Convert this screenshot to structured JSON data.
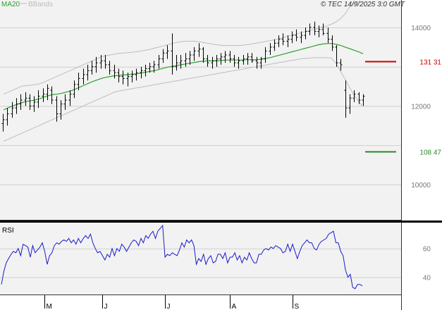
{
  "header": {
    "ma_label": "MA20",
    "bb_label": "BBands",
    "stamp": "© TEC 14/9/2025 3:0 GMT"
  },
  "colors": {
    "panel_bg": "#f2f2f2",
    "grid": "#cfcfcf",
    "price_bar": "#000000",
    "ma": "#2ca02c",
    "bbands": "#bdbdbd",
    "rsi_line": "#1a1acc",
    "resistance": "#cc0000",
    "support": "#2a8a2a",
    "tick_text": "#777777"
  },
  "chart_data": [
    {
      "type": "ohlc",
      "panel": "price",
      "x": [
        "start",
        "end"
      ],
      "ylim": [
        9100,
        14700
      ],
      "yticks": [
        10000,
        12000,
        14000
      ],
      "ytick_labels": [
        "10000",
        "12000",
        "14000"
      ],
      "grid": true,
      "legend": "top-left",
      "levels": [
        {
          "name": "resistance",
          "value": 13131,
          "label": "131 31",
          "color": "#cc0000"
        },
        {
          "name": "support",
          "value": 10847,
          "label": "108 47",
          "color": "#2a8a2a"
        }
      ],
      "bars": [
        [
          11550,
          11800,
          11350,
          11650
        ],
        [
          11650,
          11950,
          11500,
          11800
        ],
        [
          11800,
          12100,
          11700,
          11950
        ],
        [
          11950,
          12200,
          11800,
          12050
        ],
        [
          12050,
          12300,
          11900,
          12150
        ],
        [
          12150,
          12350,
          12000,
          12200
        ],
        [
          12200,
          12300,
          11900,
          12000
        ],
        [
          12000,
          12250,
          11850,
          12100
        ],
        [
          12100,
          12400,
          11950,
          12250
        ],
        [
          12250,
          12450,
          12100,
          12300
        ],
        [
          12300,
          12550,
          12150,
          12450
        ],
        [
          12400,
          12500,
          12050,
          12150
        ],
        [
          12150,
          12250,
          11600,
          11800
        ],
        [
          11800,
          12150,
          11650,
          12050
        ],
        [
          12050,
          12300,
          11900,
          12150
        ],
        [
          12150,
          12400,
          12000,
          12300
        ],
        [
          12300,
          12650,
          12200,
          12550
        ],
        [
          12550,
          12850,
          12400,
          12700
        ],
        [
          12700,
          12950,
          12550,
          12800
        ],
        [
          12800,
          13050,
          12650,
          12900
        ],
        [
          12900,
          13150,
          12800,
          13000
        ],
        [
          13000,
          13250,
          12850,
          13100
        ],
        [
          13100,
          13300,
          12950,
          13150
        ],
        [
          13150,
          13300,
          12950,
          13050
        ],
        [
          13050,
          13150,
          12800,
          12900
        ],
        [
          12900,
          13050,
          12700,
          12850
        ],
        [
          12850,
          12950,
          12600,
          12750
        ],
        [
          12750,
          12900,
          12550,
          12700
        ],
        [
          12700,
          12850,
          12500,
          12750
        ],
        [
          12750,
          12900,
          12600,
          12800
        ],
        [
          12800,
          12950,
          12650,
          12850
        ],
        [
          12850,
          13000,
          12700,
          12900
        ],
        [
          12900,
          13050,
          12750,
          12950
        ],
        [
          12950,
          13100,
          12850,
          13000
        ],
        [
          13000,
          13150,
          12850,
          13050
        ],
        [
          13050,
          13300,
          12950,
          13200
        ],
        [
          13200,
          13450,
          13100,
          13350
        ],
        [
          13350,
          13550,
          13200,
          13400
        ],
        [
          13400,
          13850,
          12800,
          13000
        ],
        [
          13000,
          13300,
          12900,
          13100
        ],
        [
          13100,
          13300,
          12950,
          13150
        ],
        [
          13150,
          13350,
          13000,
          13200
        ],
        [
          13200,
          13400,
          13050,
          13300
        ],
        [
          13300,
          13500,
          13150,
          13400
        ],
        [
          13400,
          13600,
          13250,
          13450
        ],
        [
          13450,
          13500,
          13100,
          13200
        ],
        [
          13200,
          13300,
          13000,
          13100
        ],
        [
          13100,
          13250,
          12950,
          13150
        ],
        [
          13150,
          13300,
          13000,
          13200
        ],
        [
          13200,
          13350,
          13050,
          13250
        ],
        [
          13250,
          13400,
          13100,
          13300
        ],
        [
          13300,
          13400,
          13100,
          13200
        ],
        [
          13200,
          13300,
          13000,
          13100
        ],
        [
          13100,
          13250,
          12950,
          13150
        ],
        [
          13150,
          13300,
          13050,
          13200
        ],
        [
          13200,
          13350,
          13050,
          13250
        ],
        [
          13250,
          13350,
          13100,
          13150
        ],
        [
          13150,
          13250,
          12950,
          13100
        ],
        [
          13100,
          13250,
          12950,
          13200
        ],
        [
          13200,
          13500,
          13100,
          13400
        ],
        [
          13400,
          13600,
          13300,
          13500
        ],
        [
          13500,
          13700,
          13400,
          13600
        ],
        [
          13600,
          13800,
          13500,
          13700
        ],
        [
          13700,
          13850,
          13550,
          13650
        ],
        [
          13650,
          13800,
          13500,
          13700
        ],
        [
          13700,
          13900,
          13600,
          13800
        ],
        [
          13800,
          13950,
          13650,
          13750
        ],
        [
          13750,
          13900,
          13600,
          13800
        ],
        [
          13800,
          14000,
          13700,
          13900
        ],
        [
          13900,
          14100,
          13800,
          14000
        ],
        [
          14000,
          14150,
          13800,
          13900
        ],
        [
          13900,
          14050,
          13750,
          13950
        ],
        [
          13950,
          14100,
          13800,
          13850
        ],
        [
          13850,
          14000,
          13600,
          13700
        ],
        [
          13700,
          13800,
          13400,
          13500
        ],
        [
          13500,
          13550,
          13000,
          13100
        ],
        [
          13100,
          13200,
          12900,
          13050
        ],
        [
          12400,
          12650,
          11700,
          11950
        ],
        [
          11950,
          12300,
          11800,
          12200
        ],
        [
          12200,
          12400,
          12100,
          12300
        ],
        [
          12300,
          12350,
          12050,
          12150
        ],
        [
          12150,
          12300,
          12000,
          12250
        ]
      ],
      "ma20": [
        11900,
        11950,
        12000,
        12040,
        12080,
        12110,
        12130,
        12150,
        12180,
        12220,
        12260,
        12290,
        12300,
        12320,
        12350,
        12380,
        12420,
        12470,
        12520,
        12570,
        12620,
        12660,
        12700,
        12730,
        12750,
        12770,
        12780,
        12790,
        12800,
        12810,
        12820,
        12840,
        12860,
        12880,
        12900,
        12930,
        12960,
        12990,
        13010,
        13030,
        13050,
        13070,
        13090,
        13110,
        13130,
        13140,
        13150,
        13150,
        13150,
        13160,
        13170,
        13170,
        13170,
        13170,
        13170,
        13180,
        13180,
        13180,
        13190,
        13210,
        13230,
        13260,
        13290,
        13320,
        13350,
        13380,
        13410,
        13440,
        13470,
        13500,
        13530,
        13560,
        13580,
        13590,
        13590,
        13570,
        13540,
        13500,
        13460,
        13420,
        13380,
        13330
      ],
      "bb_upper": [
        12300,
        12350,
        12400,
        12450,
        12500,
        12520,
        12530,
        12540,
        12560,
        12600,
        12650,
        12700,
        12750,
        12800,
        12850,
        12900,
        12950,
        13000,
        13050,
        13100,
        13150,
        13200,
        13250,
        13280,
        13300,
        13320,
        13340,
        13350,
        13360,
        13370,
        13380,
        13400,
        13420,
        13440,
        13470,
        13500,
        13530,
        13560,
        13590,
        13620,
        13640,
        13650,
        13650,
        13650,
        13640,
        13620,
        13600,
        13580,
        13560,
        13550,
        13540,
        13540,
        13540,
        13540,
        13550,
        13560,
        13580,
        13600,
        13620,
        13640,
        13660,
        13680,
        13710,
        13740,
        13770,
        13800,
        13830,
        13860,
        13890,
        13920,
        13950,
        13980,
        14010,
        14040,
        14080,
        14140,
        14220,
        14330,
        14500,
        14600,
        14650,
        14650
      ],
      "bb_lower": [
        11100,
        11150,
        11200,
        11250,
        11300,
        11350,
        11400,
        11450,
        11500,
        11550,
        11600,
        11650,
        11700,
        11750,
        11800,
        11850,
        11900,
        11950,
        12000,
        12050,
        12100,
        12150,
        12200,
        12250,
        12300,
        12350,
        12380,
        12400,
        12420,
        12440,
        12460,
        12480,
        12500,
        12520,
        12540,
        12560,
        12580,
        12600,
        12620,
        12640,
        12660,
        12680,
        12700,
        12720,
        12740,
        12760,
        12780,
        12800,
        12820,
        12840,
        12860,
        12880,
        12900,
        12920,
        12940,
        12960,
        12980,
        13000,
        13020,
        13040,
        13060,
        13080,
        13100,
        13120,
        13140,
        13160,
        13180,
        13200,
        13210,
        13220,
        13230,
        13230,
        13230,
        13230,
        13220,
        13100,
        12900,
        12700,
        12500,
        12300,
        12150,
        12000
      ]
    },
    {
      "type": "line",
      "panel": "rsi",
      "name": "RSI",
      "x": [
        "start",
        "end"
      ],
      "ylim": [
        28,
        78
      ],
      "yticks": [
        40,
        60
      ],
      "ytick_labels": [
        "40",
        "60"
      ],
      "xticks": [
        {
          "label": "M",
          "index": 18
        },
        {
          "label": "J",
          "index": 42
        },
        {
          "label": "J",
          "index": 68
        },
        {
          "label": "A",
          "index": 95
        },
        {
          "label": "S",
          "index": 121
        }
      ],
      "values": [
        35,
        44,
        50,
        53,
        56,
        58,
        57,
        60,
        55,
        63,
        62,
        61,
        54,
        62,
        57,
        59,
        61,
        64,
        58,
        49,
        55,
        57,
        62,
        64,
        63,
        65,
        66,
        65,
        67,
        64,
        66,
        63,
        67,
        64,
        67,
        69,
        67,
        70,
        64,
        60,
        57,
        58,
        55,
        52,
        56,
        54,
        60,
        55,
        60,
        58,
        63,
        61,
        58,
        61,
        64,
        66,
        65,
        62,
        67,
        64,
        69,
        67,
        70,
        72,
        67,
        72,
        74,
        76,
        54,
        56,
        55,
        57,
        56,
        55,
        59,
        64,
        61,
        66,
        64,
        66,
        62,
        49,
        53,
        51,
        56,
        49,
        53,
        55,
        50,
        51,
        56,
        56,
        53,
        57,
        50,
        54,
        54,
        57,
        52,
        55,
        50,
        54,
        52,
        57,
        53,
        50,
        50,
        56,
        56,
        59,
        60,
        59,
        61,
        60,
        62,
        61,
        60,
        57,
        58,
        63,
        58,
        63,
        58,
        53,
        58,
        62,
        64,
        66,
        64,
        64,
        60,
        59,
        63,
        65,
        66,
        67,
        70,
        71,
        72,
        64,
        64,
        58,
        55,
        45,
        40,
        42,
        33,
        32,
        35,
        35,
        34
      ],
      "grid": true
    }
  ]
}
